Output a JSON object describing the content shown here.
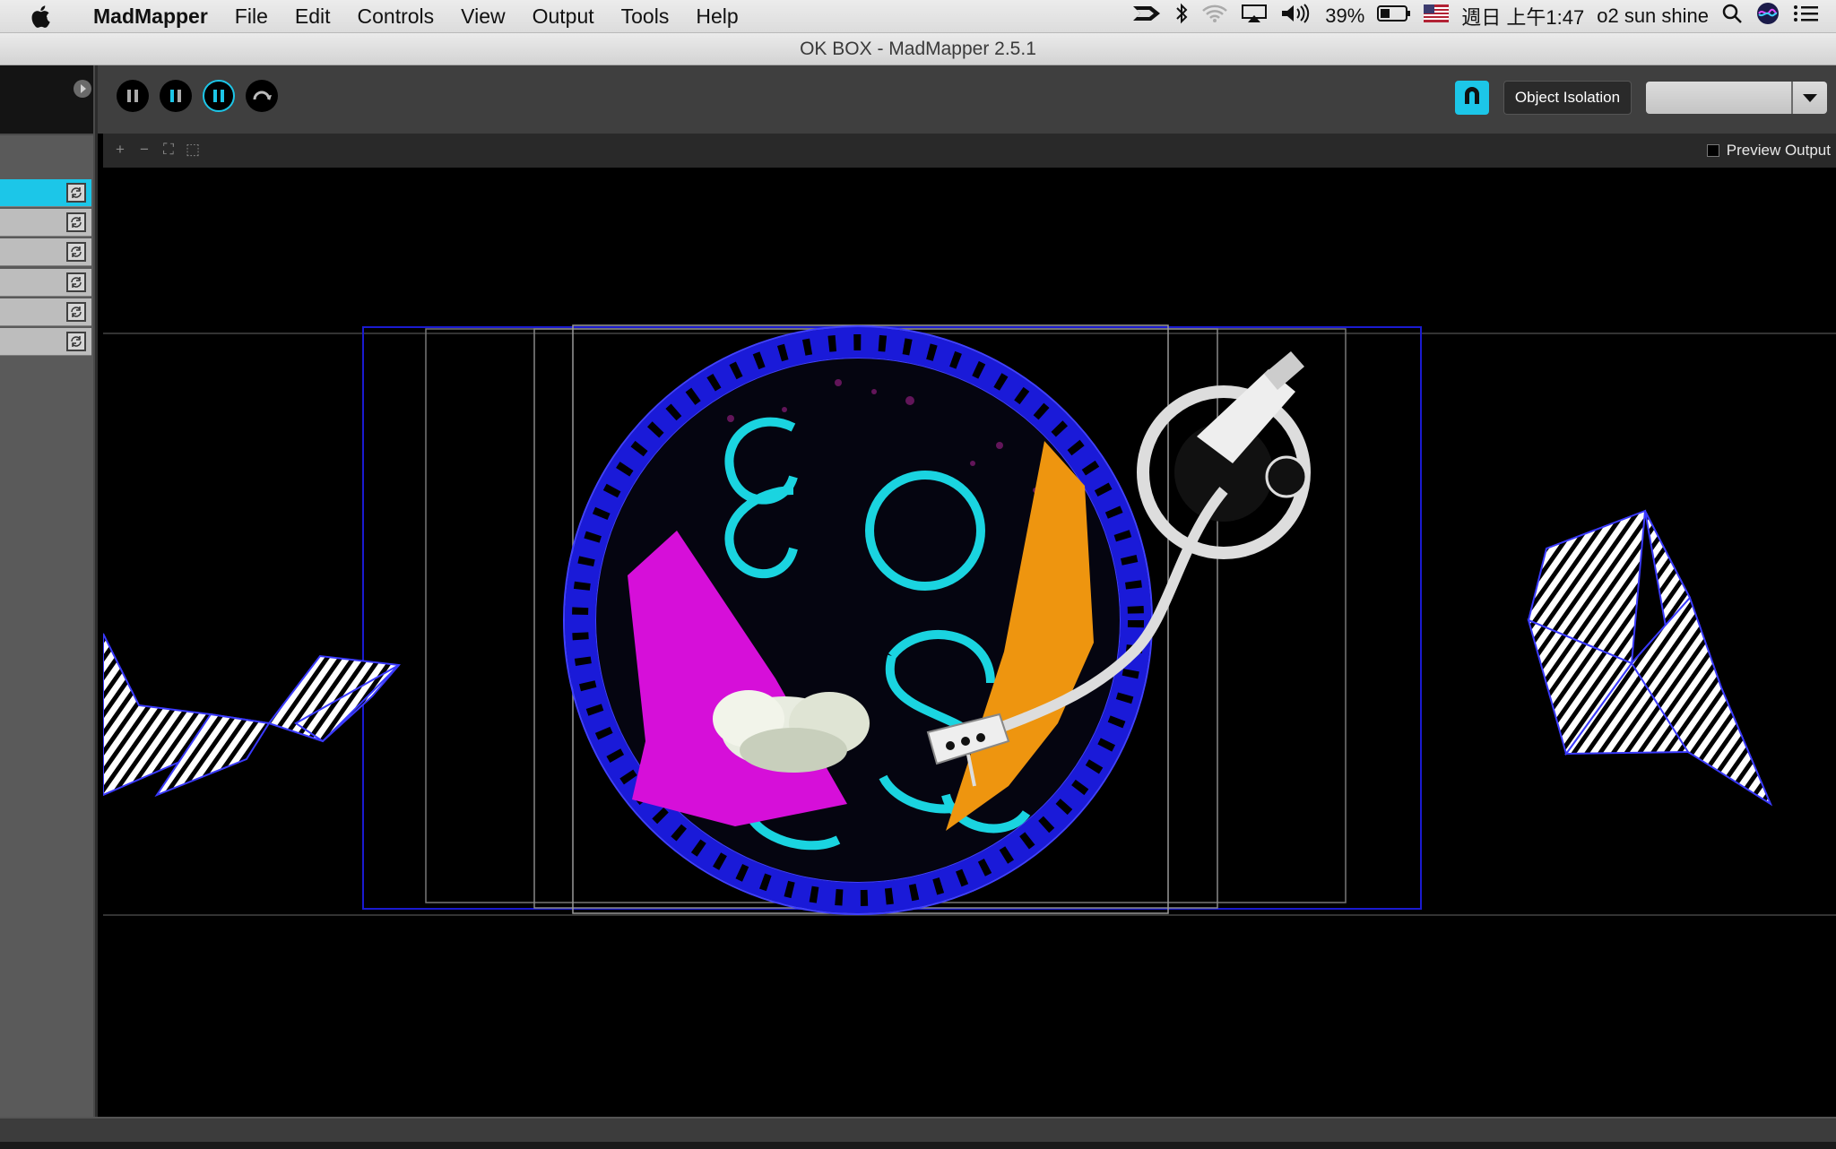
{
  "menubar": {
    "app_name": "MadMapper",
    "menus": [
      "File",
      "Edit",
      "Controls",
      "View",
      "Output",
      "Tools",
      "Help"
    ],
    "battery": "39%",
    "clock": "週日 上午1:47",
    "user": "o2 sun shine",
    "icons": [
      "apple-icon",
      "status-icon",
      "bluetooth-icon",
      "wifi-icon",
      "airplay-icon",
      "volume-icon",
      "battery-icon",
      "us-flag-icon",
      "spotlight-icon",
      "siri-icon",
      "notification-center-icon"
    ]
  },
  "window": {
    "title": "OK BOX - MadMapper 2.5.1"
  },
  "toolbar": {
    "transport_buttons": [
      "pause-icon",
      "pause-cyan-icon",
      "pause-ring-icon",
      "rotate-icon"
    ],
    "object_isolation_label": "Object Isolation",
    "dropdown_value": "",
    "accent_color": "#1cc6e8"
  },
  "viewport": {
    "zoom_controls": [
      "+",
      "−",
      "⛶",
      "⬚"
    ],
    "preview_output_label": "Preview Output"
  },
  "sidebar": {
    "rows": [
      {
        "selected": true
      },
      {
        "selected": false
      },
      {
        "selected": false
      },
      {
        "selected": false
      },
      {
        "selected": false
      },
      {
        "selected": false
      }
    ]
  }
}
